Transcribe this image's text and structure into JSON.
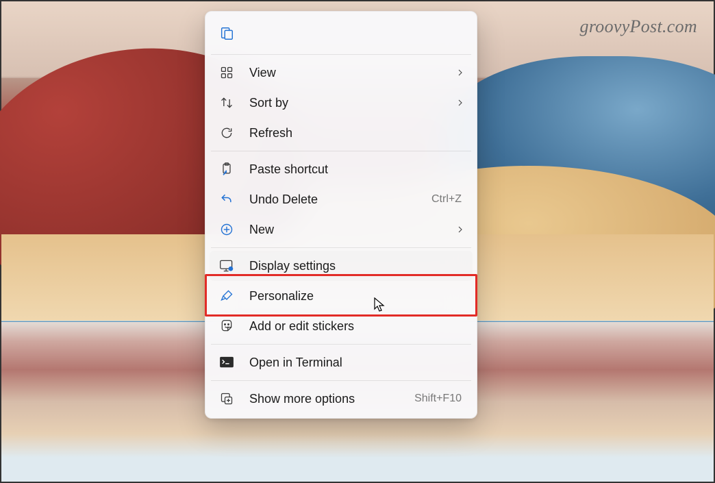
{
  "watermark": "groovyPost.com",
  "menu": {
    "view": {
      "label": "View",
      "has_submenu": true
    },
    "sort_by": {
      "label": "Sort by",
      "has_submenu": true
    },
    "refresh": {
      "label": "Refresh"
    },
    "paste_shortcut": {
      "label": "Paste shortcut"
    },
    "undo_delete": {
      "label": "Undo Delete",
      "shortcut": "Ctrl+Z"
    },
    "new": {
      "label": "New",
      "has_submenu": true
    },
    "display_settings": {
      "label": "Display settings",
      "highlighted": true
    },
    "personalize": {
      "label": "Personalize"
    },
    "stickers": {
      "label": "Add or edit stickers"
    },
    "open_terminal": {
      "label": "Open in Terminal"
    },
    "show_more": {
      "label": "Show more options",
      "shortcut": "Shift+F10"
    }
  }
}
